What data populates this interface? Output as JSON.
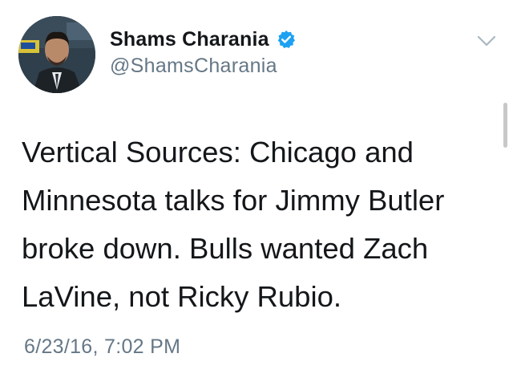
{
  "author": {
    "display_name": "Shams Charania",
    "handle": "@ShamsCharania",
    "verified": true,
    "avatar_icon": "profile-photo"
  },
  "tweet": {
    "text": "Vertical Sources: Chicago and Minnesota talks for Jimmy Butler broke down. Bulls wanted Zach LaVine, not Ricky Rubio.",
    "timestamp": "6/23/16, 7:02 PM"
  },
  "controls": {
    "menu_icon": "chevron-down-icon"
  },
  "colors": {
    "text": "#14171a",
    "secondary": "#657786",
    "verified": "#1da1f2"
  }
}
